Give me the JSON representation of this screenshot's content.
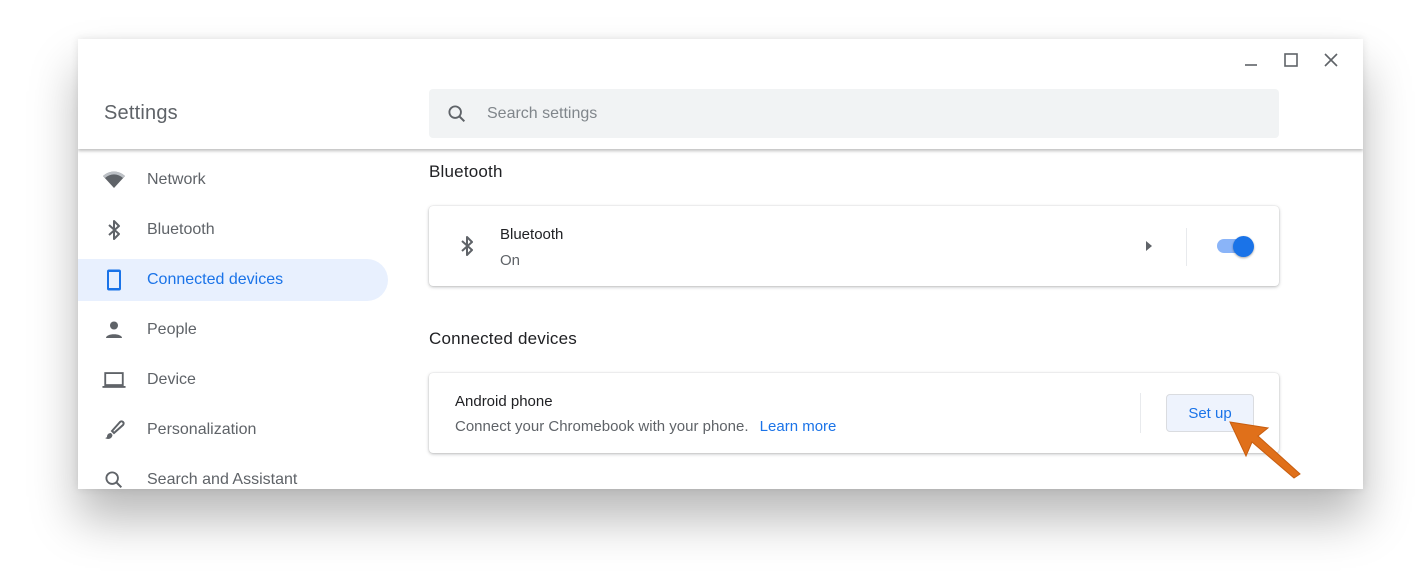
{
  "window": {
    "controls": [
      {
        "name": "minimize",
        "icon": "minimize-icon"
      },
      {
        "name": "maximize",
        "icon": "maximize-icon"
      },
      {
        "name": "close",
        "icon": "close-icon"
      }
    ]
  },
  "header": {
    "title": "Settings",
    "search": {
      "placeholder": "Search settings",
      "value": "",
      "icon": "search-icon"
    }
  },
  "sidebar": {
    "items": [
      {
        "label": "Network",
        "icon": "wifi-icon",
        "active": false
      },
      {
        "label": "Bluetooth",
        "icon": "bluetooth-icon",
        "active": false
      },
      {
        "label": "Connected devices",
        "icon": "phone-icon",
        "active": true
      },
      {
        "label": "People",
        "icon": "person-icon",
        "active": false
      },
      {
        "label": "Device",
        "icon": "laptop-icon",
        "active": false
      },
      {
        "label": "Personalization",
        "icon": "brush-icon",
        "active": false
      },
      {
        "label": "Search and Assistant",
        "icon": "search-icon",
        "active": false
      }
    ]
  },
  "main": {
    "bluetooth_section": {
      "title": "Bluetooth",
      "card": {
        "name": "Bluetooth",
        "status": "On",
        "toggle_on": true,
        "icon": "bluetooth-icon"
      }
    },
    "connected_section": {
      "title": "Connected devices",
      "card": {
        "name": "Android phone",
        "description": "Connect your Chromebook with your phone.",
        "link_label": "Learn more",
        "button_label": "Set up"
      }
    }
  },
  "colors": {
    "accent": "#1a73e8",
    "active_bg": "#e8f0fe",
    "pointer_arrow": "#e0701a"
  }
}
